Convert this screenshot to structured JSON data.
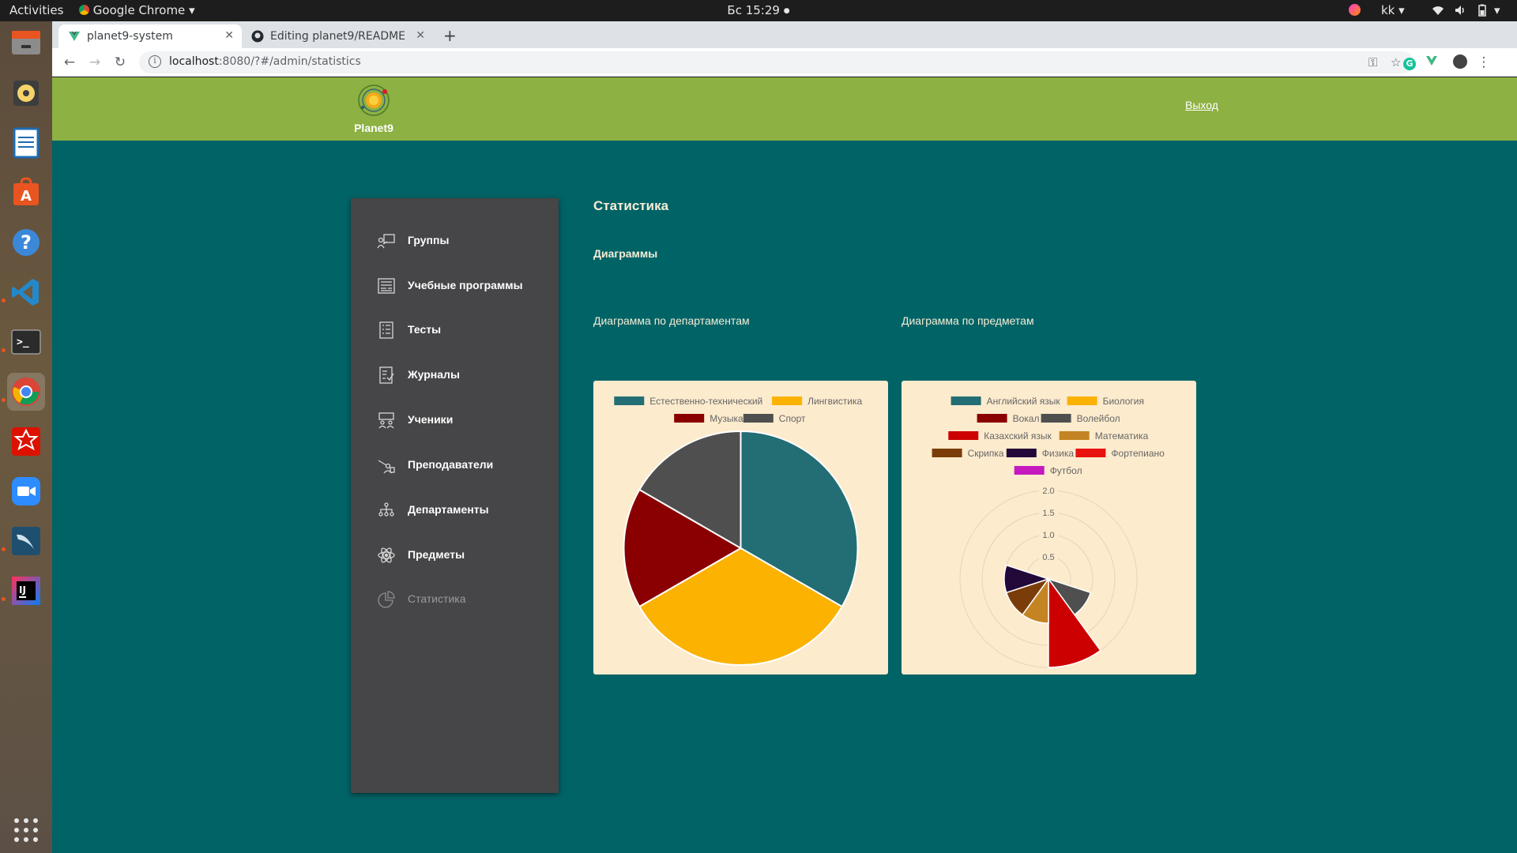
{
  "topbar": {
    "activities": "Activities",
    "app_name": "Google Chrome",
    "clock": "Бс 15:29",
    "user": "kk"
  },
  "browser": {
    "tabs": [
      {
        "title": "planet9-system",
        "active": true
      },
      {
        "title": "Editing planet9/README",
        "active": false
      }
    ],
    "url_host": "localhost",
    "url_rest": ":8080/?#/admin/statistics"
  },
  "header": {
    "logo_text": "Planet9",
    "logout": "Выход",
    "color": "#8db142"
  },
  "sidebar": {
    "items": [
      {
        "label": "Группы",
        "icon": "groups-icon"
      },
      {
        "label": "Учебные программы",
        "icon": "curriculum-icon"
      },
      {
        "label": "Тесты",
        "icon": "tests-icon"
      },
      {
        "label": "Журналы",
        "icon": "journal-icon"
      },
      {
        "label": "Ученики",
        "icon": "students-icon"
      },
      {
        "label": "Преподаватели",
        "icon": "teachers-icon"
      },
      {
        "label": "Департаменты",
        "icon": "departments-icon"
      },
      {
        "label": "Предметы",
        "icon": "atom-icon"
      },
      {
        "label": "Статистика",
        "icon": "pie-chart-icon",
        "current": true
      }
    ]
  },
  "content": {
    "title": "Статистика",
    "subtitle": "Диаграммы",
    "chart1_caption": "Диаграмма по департаментам",
    "chart2_caption": "Диаграмма по предметам"
  },
  "chart_data": [
    {
      "type": "pie",
      "categories": [
        "Естественно-технический",
        "Лингвистика",
        "Музыка",
        "Спорт"
      ],
      "values": [
        2,
        2,
        1,
        1
      ],
      "colors": [
        "#236d75",
        "#fbb201",
        "#8a0000",
        "#4f4f4f"
      ],
      "legend": "top"
    },
    {
      "type": "polarArea",
      "categories": [
        "Английский язык",
        "Биология",
        "Вокал",
        "Волейбол",
        "Казахский язык",
        "Математика",
        "Скрипка",
        "Физика",
        "Фортепиано",
        "Футбол"
      ],
      "values": [
        0,
        0,
        0,
        1,
        2,
        1,
        1,
        1,
        0,
        0
      ],
      "colors": [
        "#236d75",
        "#fbb201",
        "#8a0000",
        "#4f4f4f",
        "#cc0000",
        "#c48423",
        "#7a3d0a",
        "#22093a",
        "#e8120e",
        "#c519c0"
      ],
      "r_ticks": [
        "0.5",
        "1.0",
        "1.5",
        "2.0"
      ],
      "r_max": 2,
      "legend": "top"
    }
  ]
}
